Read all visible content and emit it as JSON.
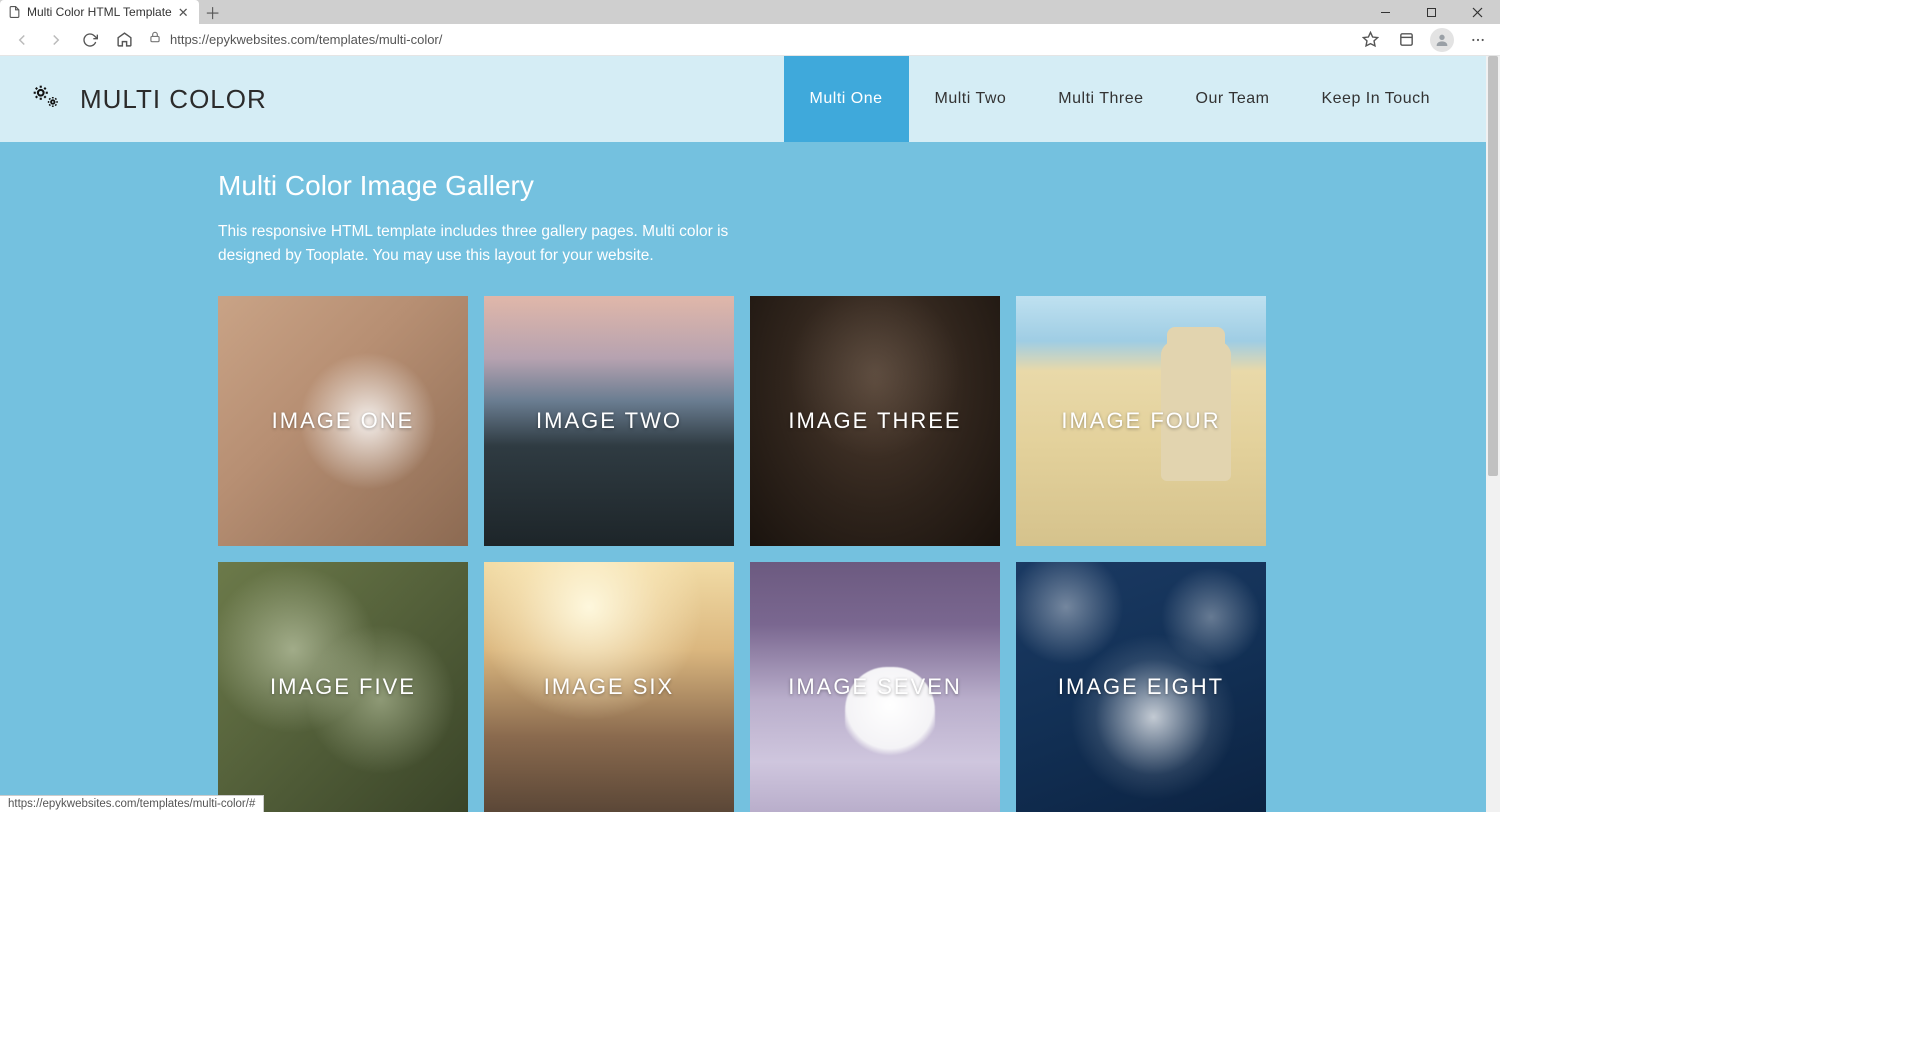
{
  "browser": {
    "tab_title": "Multi Color HTML Template",
    "url": "https://epykwebsites.com/templates/multi-color/",
    "status_url": "https://epykwebsites.com/templates/multi-color/#"
  },
  "header": {
    "brand": "MULTI COLOR",
    "nav": [
      "Multi One",
      "Multi Two",
      "Multi Three",
      "Our Team",
      "Keep In Touch"
    ],
    "active_index": 0
  },
  "content": {
    "title": "Multi Color Image Gallery",
    "description": "This responsive HTML template includes three gallery pages. Multi color is designed by Tooplate. You may use this layout for your website."
  },
  "gallery": [
    {
      "label": "IMAGE ONE"
    },
    {
      "label": "IMAGE TWO"
    },
    {
      "label": "IMAGE THREE"
    },
    {
      "label": "IMAGE FOUR"
    },
    {
      "label": "IMAGE FIVE"
    },
    {
      "label": "IMAGE SIX"
    },
    {
      "label": "IMAGE SEVEN"
    },
    {
      "label": "IMAGE EIGHT"
    }
  ],
  "colors": {
    "header_bg": "#d5edf5",
    "nav_active": "#3fa9db",
    "content_bg": "#74c1df"
  }
}
